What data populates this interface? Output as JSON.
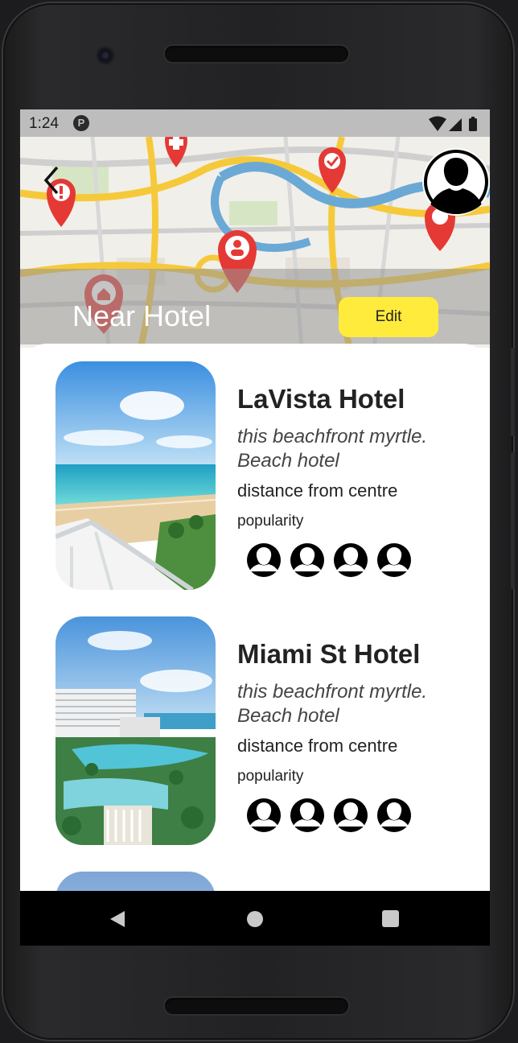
{
  "status_bar": {
    "time": "1:24",
    "app_badge": "P",
    "icons": [
      "wifi-icon",
      "signal-icon",
      "battery-icon"
    ]
  },
  "header": {
    "title": "Near Hotel",
    "edit_label": "Edit",
    "back_icon": "chevron-left-icon",
    "avatar_icon": "person-silhouette-icon",
    "background": "city-map-with-pins"
  },
  "hotels": [
    {
      "name": "LaVista Hotel",
      "description": "this beachfront myrtle. Beach hotel",
      "distance": "distance from centre",
      "popularity_label": "popularity",
      "popularity_count": 4,
      "photo": "beach-balcony-photo"
    },
    {
      "name": "Miami St Hotel",
      "description": "this beachfront myrtle. Beach hotel",
      "distance": "distance from centre",
      "popularity_label": "popularity",
      "popularity_count": 4,
      "photo": "resort-pool-photo"
    }
  ],
  "navigation": {
    "back_icon": "triangle-back-icon",
    "home_icon": "circle-home-icon",
    "recents_icon": "square-recents-icon"
  },
  "colors": {
    "accent": "#ffeb3b",
    "map_road": "#f6c93a",
    "map_water": "#6aa9d6",
    "pin": "#e53935"
  }
}
